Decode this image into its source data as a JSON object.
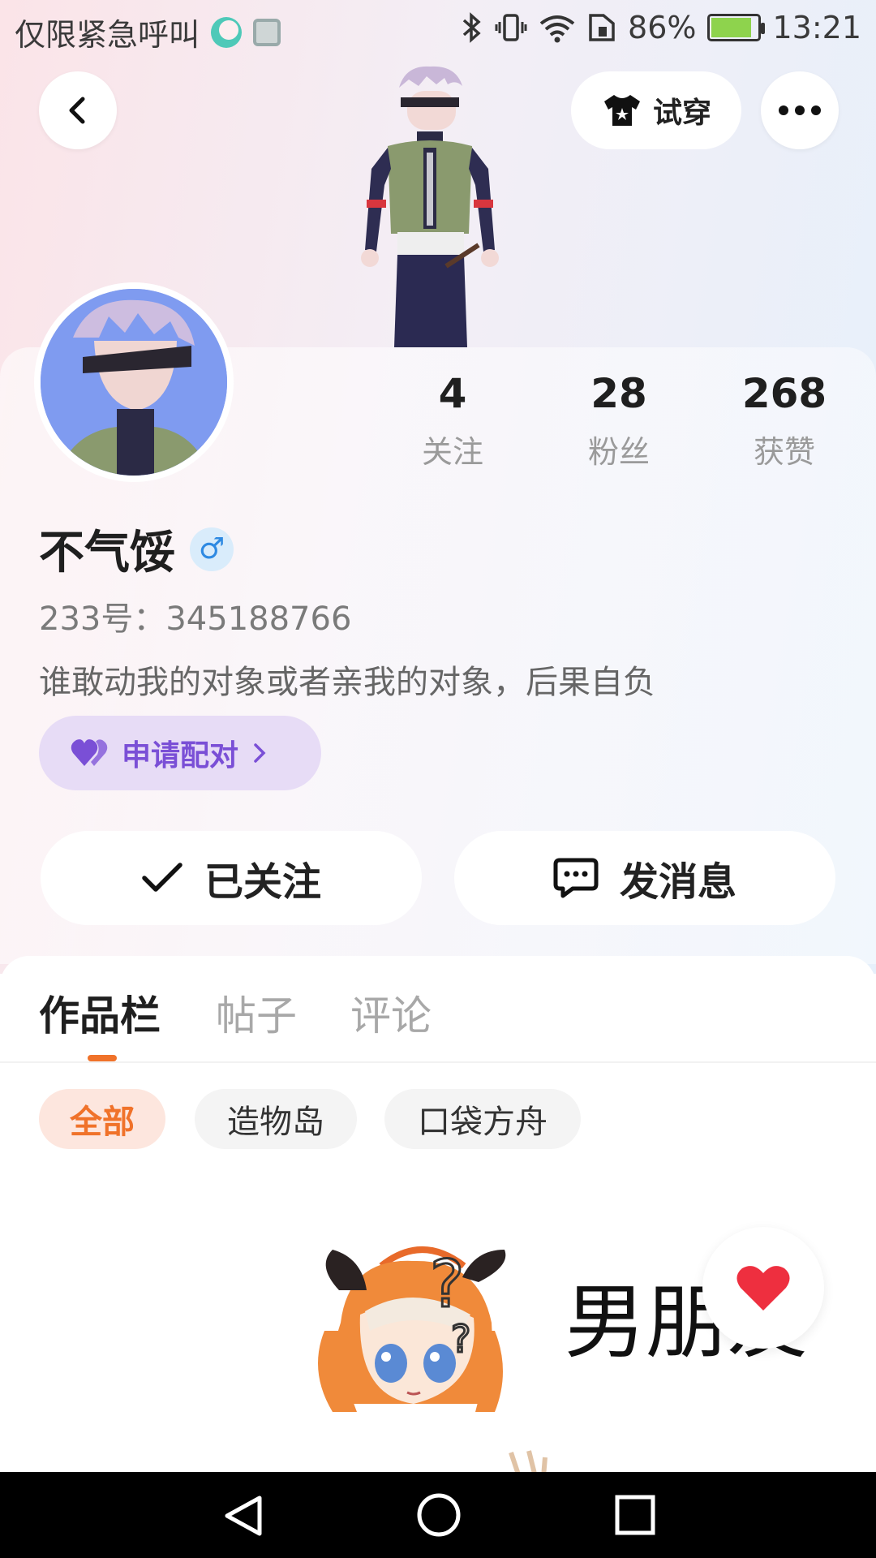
{
  "status_bar": {
    "carrier_text": "仅限紧急呼叫",
    "battery_percent": "86%",
    "battery_level": 0.86,
    "time": "13:21"
  },
  "header": {
    "try_on_label": "试穿"
  },
  "stats": [
    {
      "value": "4",
      "label": "关注"
    },
    {
      "value": "28",
      "label": "粉丝"
    },
    {
      "value": "268",
      "label": "获赞"
    }
  ],
  "profile": {
    "name": "不气馁",
    "gender_symbol": "♂",
    "uid_text": "233号：345188766",
    "bio": "谁敢动我的对象或者亲我的对象，后果自负",
    "pair_label": "申请配对"
  },
  "actions": {
    "follow_label": "已关注",
    "message_label": "发消息"
  },
  "tabs": [
    {
      "label": "作品栏",
      "active": true
    },
    {
      "label": "帖子",
      "active": false
    },
    {
      "label": "评论",
      "active": false
    }
  ],
  "filters": [
    {
      "label": "全部",
      "active": true
    },
    {
      "label": "造物岛",
      "active": false
    },
    {
      "label": "口袋方舟",
      "active": false
    }
  ],
  "content": {
    "sticker_text": "男朋友"
  },
  "colors": {
    "accent": "#f0722a",
    "pair_purple": "#7a4fd6",
    "gender_blue": "#2f8ae2",
    "battery_green": "#8ed34d"
  }
}
